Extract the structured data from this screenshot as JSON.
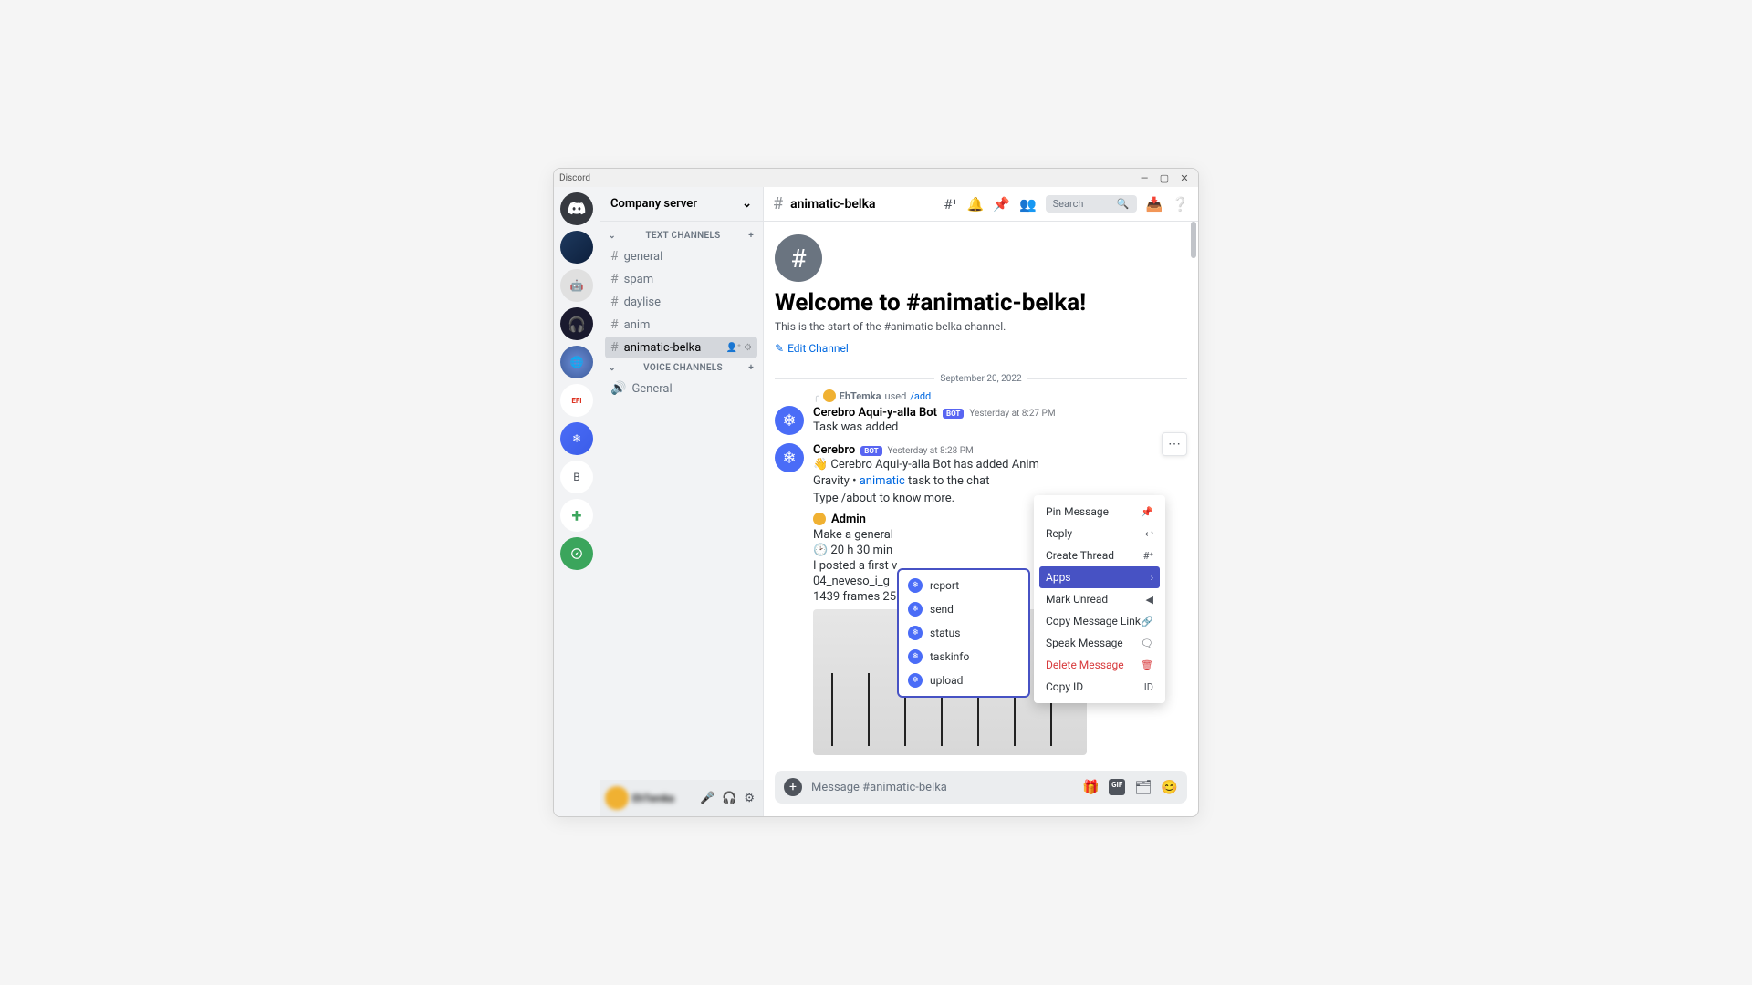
{
  "titlebar": {
    "app": "Discord"
  },
  "server_header": "Company server",
  "text_channels_label": "TEXT CHANNELS",
  "voice_channels_label": "VOICE CHANNELS",
  "text_channels": [
    "general",
    "spam",
    "daylise",
    "anim",
    "animatic-belka"
  ],
  "voice_channels": [
    "General"
  ],
  "active_channel": "animatic-belka",
  "header": {
    "channel": "animatic-belka",
    "search_placeholder": "Search"
  },
  "welcome": {
    "title": "Welcome to #animatic-belka!",
    "sub": "This is the start of the #animatic-belka channel.",
    "edit": "Edit Channel"
  },
  "date_divider": "September 20, 2022",
  "reply": {
    "user": "EhTemka",
    "action": "used",
    "cmd": "/add"
  },
  "msg1": {
    "author": "Cerebro Aqui-y-alla Bot",
    "bot": "BOT",
    "time": "Yesterday at 8:27 PM",
    "text": "Task was added"
  },
  "msg2": {
    "author": "Cerebro",
    "bot": "BOT",
    "time": "Yesterday at 8:28 PM",
    "l1a": "👋 Cerebro Aqui-y-alla Bot has added Anim",
    "l1b": "Gravity • ",
    "l1link": "animatic",
    "l1c": " task to the chat",
    "l2": "Type /about to know more."
  },
  "sub": {
    "name": "Admin",
    "l1": "Make a general",
    "l2": "🕑 20 h 30 min",
    "l3": "I posted a first v",
    "l4": "04_neveso_i_g",
    "l5": "1439 frames 25"
  },
  "ctx": {
    "pin": "Pin Message",
    "reply": "Reply",
    "thread": "Create Thread",
    "apps": "Apps",
    "unread": "Mark Unread",
    "copylink": "Copy Message Link",
    "speak": "Speak Message",
    "delete": "Delete Message",
    "copyid": "Copy ID"
  },
  "apps": [
    "report",
    "send",
    "status",
    "taskinfo",
    "upload"
  ],
  "input": {
    "placeholder": "Message #animatic-belka"
  },
  "servers": [
    {
      "id": "discord"
    },
    {
      "id": "s1"
    },
    {
      "id": "s2"
    },
    {
      "id": "s3"
    },
    {
      "id": "s4"
    },
    {
      "id": "s5"
    },
    {
      "id": "cerebro"
    },
    {
      "id": "b",
      "letter": "B"
    },
    {
      "id": "add"
    },
    {
      "id": "explore"
    }
  ]
}
